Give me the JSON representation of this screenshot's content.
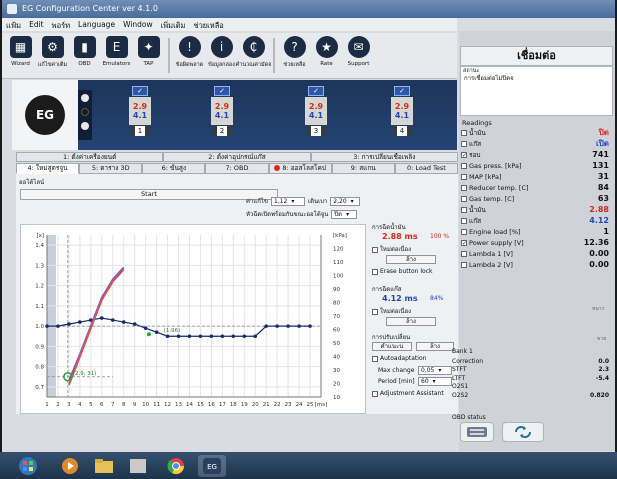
{
  "window": {
    "title": "EG Configuration Center ver 4.1.0"
  },
  "menu": [
    "แฟ้ม",
    "Edit",
    "พอร์ท",
    "Language",
    "Window",
    "เพิ่มเติม",
    "ช่วยเหลือ"
  ],
  "toolbar": [
    {
      "label": "Wizard",
      "icon": "grid-icon",
      "glyph": "▦"
    },
    {
      "label": "แก้ไขค่าเติม",
      "icon": "gear-icon",
      "glyph": "⚙"
    },
    {
      "label": "OBD",
      "icon": "plug-icon",
      "glyph": "▮"
    },
    {
      "label": "Emulators",
      "icon": "e-icon",
      "glyph": "E"
    },
    {
      "label": "TAP",
      "icon": "wand-icon",
      "glyph": "✦"
    },
    {
      "label": "ข้อผิดพลาด",
      "icon": "warning-icon",
      "glyph": "!"
    },
    {
      "label": "ข้อมูลกล่อง",
      "icon": "info-icon",
      "glyph": "i"
    },
    {
      "label": "คำนวณค่ามัดจ",
      "icon": "money-icon",
      "glyph": "₵"
    },
    {
      "label": "ช่วยเหลือ",
      "icon": "help-icon",
      "glyph": "?"
    },
    {
      "label": "Rate",
      "icon": "star-icon",
      "glyph": "★"
    },
    {
      "label": "Support",
      "icon": "support-icon",
      "glyph": "✉"
    }
  ],
  "injectors": [
    {
      "num": "1",
      "v1": "2.9",
      "v2": "4.1"
    },
    {
      "num": "2",
      "v1": "2.9",
      "v2": "4.1"
    },
    {
      "num": "3",
      "v1": "2.9",
      "v2": "4.1"
    },
    {
      "num": "4",
      "v1": "2.9",
      "v2": "4.1"
    }
  ],
  "tabs_top": [
    "1: ตั้งค่าเครื่องยนต์",
    "2: ตั้งค่าอุปกรณ์แก๊ส",
    "3: การเปลี่ยนเชื้อเพลิง"
  ],
  "tabs_bottom": [
    "4: ใหม่สูตรจูน",
    "5: ตาราง 3D",
    "6: ขั้นสูง",
    "7: OBD",
    "8: ออสโลสโคป",
    "9: สแกน",
    "0: Load Test"
  ],
  "panel": {
    "sublabel": "ออโต้ไลน์",
    "start": "Start",
    "step_label": "ค่าแก้ไข",
    "step_value": "1,12",
    "dev_label": "เดินเบา",
    "dev_value": "2,20",
    "check_label": "หัวฉีดเปิดพร้อมกันขณะออโต้จูน",
    "check_value": "ปิด"
  },
  "chart_data": {
    "type": "line",
    "title": "",
    "xlabel": "",
    "ylabel": "",
    "x_ticks": [
      "1",
      "2",
      "3",
      "4",
      "5",
      "6",
      "7",
      "8",
      "9",
      "10",
      "11",
      "12",
      "13",
      "14",
      "15",
      "16",
      "17",
      "18",
      "19",
      "20",
      "21",
      "22",
      "23",
      "24",
      "25",
      "[ms]"
    ],
    "y_left_ticks": [
      "[x]",
      "1.4",
      "1.3",
      "1.2",
      "1.1",
      "1.0",
      "0.9",
      "0.8",
      "0.7"
    ],
    "y_right_ticks": [
      "[kPa]",
      "120",
      "110",
      "100",
      "90",
      "80",
      "70",
      "60",
      "50",
      "40",
      "30",
      "20",
      "10"
    ],
    "xlim": [
      1,
      26
    ],
    "ylim": [
      0.65,
      1.45
    ],
    "series": [
      {
        "name": "",
        "color": "#1b2a6e",
        "x": [
          1,
          2,
          3,
          4,
          5,
          6,
          7,
          8,
          9,
          10,
          11,
          12,
          13,
          14,
          15,
          16,
          17,
          18,
          19,
          20,
          21,
          22,
          23,
          24,
          25
        ],
        "y": [
          1.0,
          1.0,
          1.01,
          1.02,
          1.03,
          1.04,
          1.03,
          1.02,
          1.01,
          0.99,
          0.97,
          0.95,
          0.95,
          0.95,
          0.95,
          0.95,
          0.95,
          0.95,
          0.95,
          0.95,
          1.0,
          1.0,
          1.0,
          1.0,
          1.0
        ]
      },
      {
        "name": "",
        "color": "#5b63d8",
        "x": [
          3,
          4,
          5,
          6,
          7,
          8
        ],
        "y": [
          0.73,
          0.86,
          1.0,
          1.14,
          1.23,
          1.29
        ]
      },
      {
        "name": "",
        "color": "#e05050",
        "x": [
          3,
          4,
          5,
          6,
          7,
          8
        ],
        "y": [
          0.71,
          0.85,
          0.99,
          1.13,
          1.22,
          1.28
        ]
      }
    ],
    "annotations": [
      {
        "text": "(2.9, 31)",
        "x": 2.9,
        "y": 0.75
      },
      {
        "text": "(1.96)",
        "x": 11.2,
        "y": 0.96
      }
    ]
  },
  "side": {
    "gas_title": "การฉีดน้ำมัน",
    "gas_ms": "2.88 ms",
    "gas_pct": "100 %",
    "gas_check": "ใหม่ต่อเนื่อง",
    "btn_a": "ล้าง",
    "erase": "Erase button lock",
    "lpg_title": "การฉีดแก๊ส",
    "lpg_ms": "4.12 ms",
    "lpg_pct": "84%",
    "lpg_check": "ใหม่ต่อเนื่อง",
    "btn_b": "ล้าง",
    "adj_title": "การปรับเปลี่ยน",
    "adj_a": "คำแนะน",
    "adj_b": "ล้าง",
    "auto": "Autoadaptation",
    "max_label": "Max change",
    "max_val": "0,05",
    "period_label": "Period [min]",
    "period_val": "60",
    "assist": "Adjustment Assistant"
  },
  "right": {
    "connect": "เชื่อมต่อ",
    "status_cap": "สถานะ",
    "status_text": "การเชื่อมต่อไม่ปิดจ",
    "readings_title": "Readings",
    "readings": [
      {
        "label": "น้ำมัน",
        "value": "ปิด",
        "checked": false,
        "color": "#d42b1e"
      },
      {
        "label": "แก๊ส",
        "value": "เปิด",
        "checked": false,
        "color": "#2347b8"
      },
      {
        "label": "รอบ",
        "value": "741",
        "checked": true,
        "color": "#111111"
      },
      {
        "label": "Gas press. [kPa]",
        "value": "131",
        "checked": false,
        "color": "#111111"
      },
      {
        "label": "MAP [kPa]",
        "value": "31",
        "checked": false,
        "color": "#111111"
      },
      {
        "label": "Reducer temp. [C]",
        "value": "84",
        "checked": false,
        "color": "#111111"
      },
      {
        "label": "Gas temp. [C]",
        "value": "63",
        "checked": false,
        "color": "#111111"
      },
      {
        "label": "น้ำมัน",
        "value": "2.88",
        "checked": false,
        "color": "#d42b1e"
      },
      {
        "label": "แก๊ส",
        "value": "4.12",
        "checked": false,
        "color": "#2347b8"
      },
      {
        "label": "Engine load [%]",
        "value": "1",
        "checked": false,
        "color": "#111111"
      },
      {
        "label": "Power supply [V]",
        "value": "12.36",
        "checked": true,
        "color": "#111111"
      },
      {
        "label": "Lambda 1 [V]",
        "value": "0.00",
        "checked": false,
        "color": "#111111"
      },
      {
        "label": "Lambda 2 [V]",
        "value": "0.00",
        "checked": false,
        "color": "#111111"
      }
    ],
    "gauge_a": "หนาว",
    "gauge_b": "ขาย",
    "bank_title": "Bank 1",
    "bank": [
      {
        "label": "Correction",
        "value": "0.0"
      },
      {
        "label": "STFT",
        "value": "2.3"
      },
      {
        "label": "LTFT",
        "value": "-5.4"
      },
      {
        "label": "O2S1",
        "value": ""
      },
      {
        "label": "O2S2",
        "value": "0.820"
      }
    ],
    "obd_status": "OBD status"
  }
}
